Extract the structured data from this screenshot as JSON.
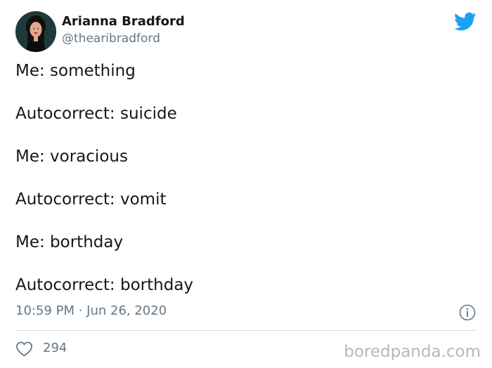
{
  "author": {
    "name": "Arianna Bradford",
    "handle": "@thearibradford"
  },
  "tweet": {
    "lines": [
      "Me: something",
      "Autocorrect: suicide",
      "Me: voracious",
      "Autocorrect: vomit",
      "Me: borthday",
      "Autocorrect: borthday"
    ],
    "timestamp": "10:59 PM · Jun 26, 2020",
    "likes": "294"
  },
  "icons": {
    "brand": "twitter-bird-icon",
    "info": "info-icon",
    "like": "heart-icon"
  },
  "colors": {
    "twitter_blue": "#1da1f2",
    "muted_text": "#657786",
    "watermark": "#b8b8b8"
  },
  "watermark": "boredpanda.com"
}
